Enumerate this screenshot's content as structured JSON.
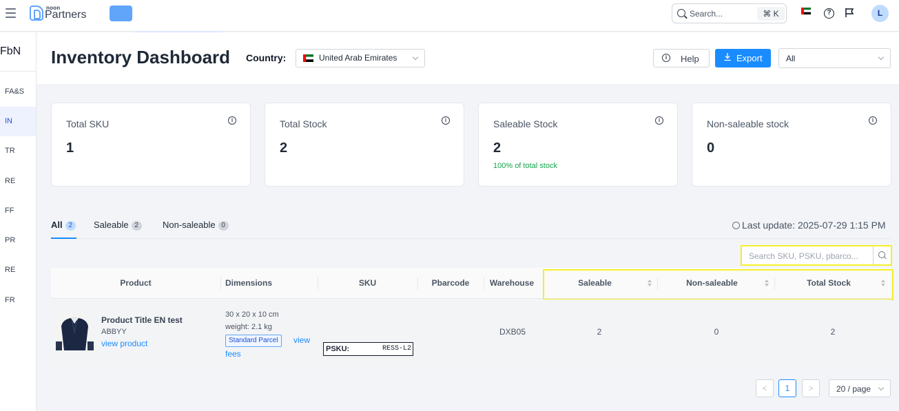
{
  "topbar": {
    "logo_small": "noon",
    "logo_big": "Partners",
    "search_placeholder": "Search...",
    "search_shortcut": "⌘ K",
    "avatar_initial": "L"
  },
  "sidebar": {
    "title": "FbN",
    "items": [
      {
        "label": "FA&S",
        "active": false
      },
      {
        "label": "IN",
        "active": true
      },
      {
        "label": "TR",
        "active": false
      },
      {
        "label": "RE",
        "active": false
      },
      {
        "label": "FF",
        "active": false
      },
      {
        "label": "PR",
        "active": false
      },
      {
        "label": "RE",
        "active": false
      },
      {
        "label": "FR",
        "active": false
      }
    ]
  },
  "header": {
    "title": "Inventory Dashboard",
    "country_label": "Country:",
    "country_value": "United Arab Emirates",
    "help_label": "Help",
    "export_label": "Export",
    "filter_value": "All"
  },
  "cards": [
    {
      "title": "Total SKU",
      "value": "1",
      "sub": ""
    },
    {
      "title": "Total Stock",
      "value": "2",
      "sub": ""
    },
    {
      "title": "Saleable Stock",
      "value": "2",
      "sub": "100% of total stock"
    },
    {
      "title": "Non-saleable stock",
      "value": "0",
      "sub": ""
    }
  ],
  "tabs": [
    {
      "label": "All",
      "count": "2"
    },
    {
      "label": "Saleable",
      "count": "2"
    },
    {
      "label": "Non-saleable",
      "count": "0"
    }
  ],
  "last_update": "Last update: 2025-07-29 1:15 PM",
  "table": {
    "search_placeholder": "Search SKU, PSKU, pbarco...",
    "columns": {
      "product": "Product",
      "dimensions": "Dimensions",
      "sku": "SKU",
      "pbarcode": "Pbarcode",
      "warehouse": "Warehouse",
      "saleable": "Saleable",
      "non_saleable": "Non-saleable",
      "total_stock": "Total Stock"
    },
    "row": {
      "title": "Product Title EN test",
      "brand": "ABBYY",
      "view_product": "view product",
      "dimensions": "30 x 20 x 10 cm",
      "weight": "weight: 2.1 kg",
      "parcel": "Standard Parcel",
      "view_fees_1": "view",
      "view_fees_2": "fees",
      "psku_label": "PSKU:",
      "psku_value": "RESS-L2",
      "warehouse": "DXB05",
      "saleable": "2",
      "non_saleable": "0",
      "total_stock": "2"
    }
  },
  "pagination": {
    "prev": "<",
    "current": "1",
    "next": ">",
    "page_size": "20 / page"
  },
  "colors": {
    "accent": "#1a8cff",
    "highlight": "#f5ef2a",
    "success": "#16a34a"
  }
}
